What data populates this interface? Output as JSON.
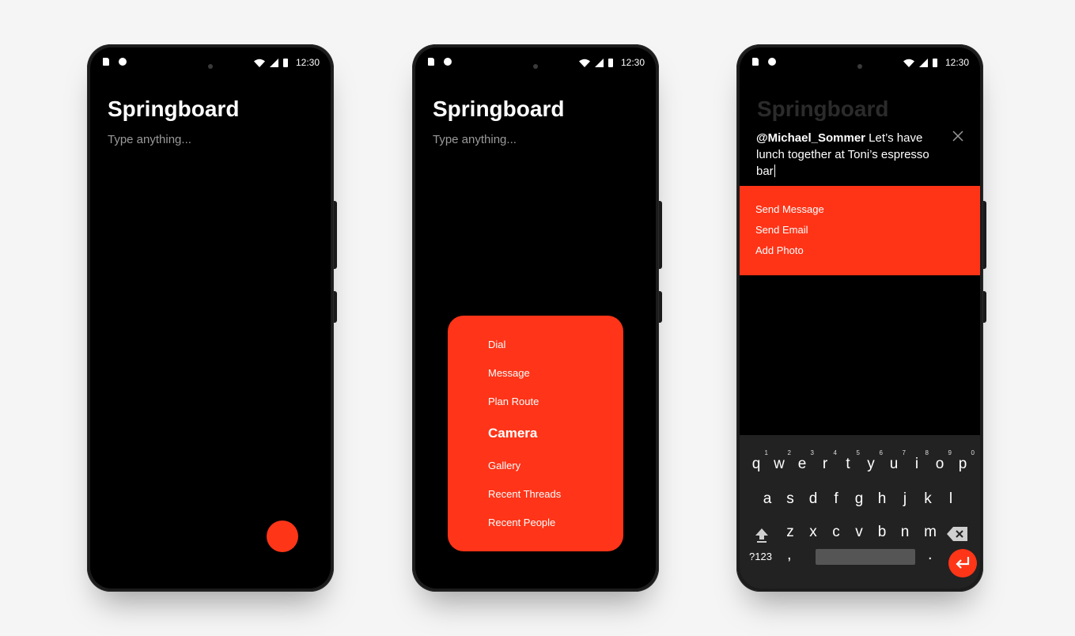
{
  "phones": [
    {
      "status": {
        "time": "12:30"
      },
      "title": "Springboard",
      "placeholder": "Type anything..."
    },
    {
      "status": {
        "time": "12:30"
      },
      "title": "Springboard",
      "placeholder": "Type anything...",
      "menu": [
        "Dial",
        "Message",
        "Plan Route",
        "Camera",
        "Gallery",
        "Recent Threads",
        "Recent People"
      ],
      "menu_selected": "Camera"
    },
    {
      "status": {
        "time": "12:30"
      },
      "title": "Springboard",
      "compose": {
        "mention": "@Michael_Sommer",
        "text": " Let’s have lunch together at Toni’s espresso bar"
      },
      "actions": [
        "Send Message",
        "Send Email",
        "Add Photo"
      ],
      "keyboard": {
        "row1": [
          "q",
          "w",
          "e",
          "r",
          "t",
          "y",
          "u",
          "i",
          "o",
          "p"
        ],
        "row1_hints": [
          "1",
          "2",
          "3",
          "4",
          "5",
          "6",
          "7",
          "8",
          "9",
          "0"
        ],
        "row2": [
          "a",
          "s",
          "d",
          "f",
          "g",
          "h",
          "j",
          "k",
          "l"
        ],
        "row3": [
          "z",
          "x",
          "c",
          "v",
          "b",
          "n",
          "m"
        ],
        "symbols_label": "?123",
        "comma": ",",
        "period": "."
      }
    }
  ],
  "colors": {
    "accent": "#ff3518",
    "screen": "#000000",
    "background": "#f5f5f5"
  }
}
